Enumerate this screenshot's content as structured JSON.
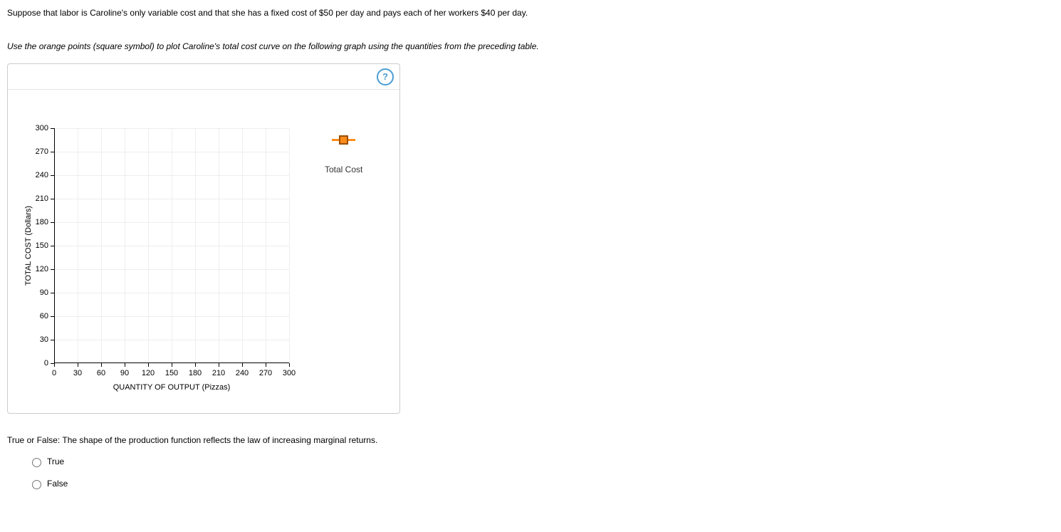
{
  "intro": "Suppose that labor is Caroline's only variable cost and that she has a fixed cost of $50 per day and pays each of her workers $40 per day.",
  "instruction": "Use the orange points (square symbol) to plot Caroline's total cost curve on the following graph using the quantities from the preceding table.",
  "help_glyph": "?",
  "legend": {
    "label": "Total Cost"
  },
  "chart_data": {
    "type": "scatter",
    "title": "",
    "xlabel": "QUANTITY OF OUTPUT (Pizzas)",
    "ylabel": "TOTAL COST (Dollars)",
    "xlim": [
      0,
      300
    ],
    "ylim": [
      0,
      300
    ],
    "x_ticks": [
      0,
      30,
      60,
      90,
      120,
      150,
      180,
      210,
      240,
      270,
      300
    ],
    "y_ticks": [
      0,
      30,
      60,
      90,
      120,
      150,
      180,
      210,
      240,
      270,
      300
    ],
    "series": [
      {
        "name": "Total Cost",
        "color": "#ff8c1a",
        "marker": "square",
        "values": []
      }
    ]
  },
  "tf_question": "True or False: The shape of the production function reflects the law of increasing marginal returns.",
  "options": {
    "true": "True",
    "false": "False"
  }
}
